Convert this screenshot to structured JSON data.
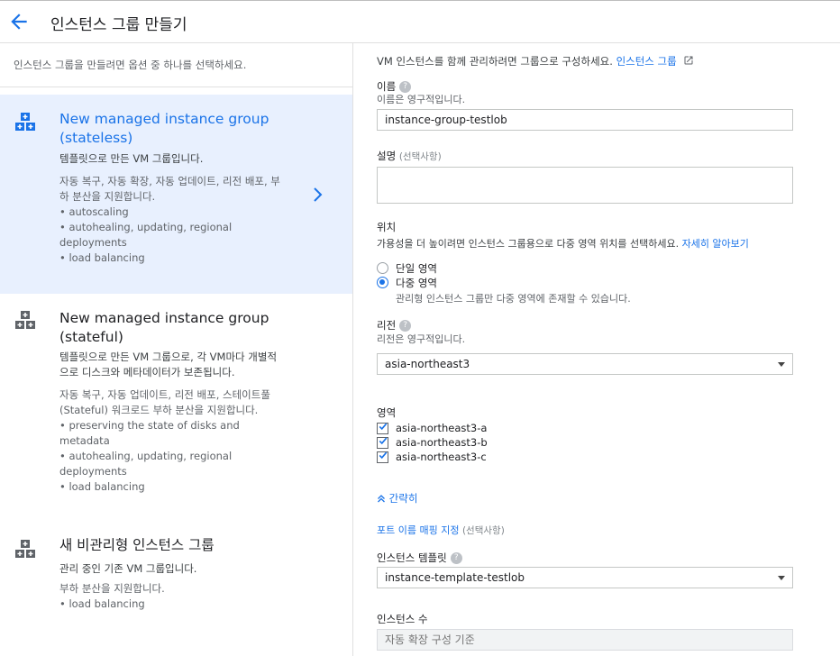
{
  "header": {
    "title": "인스턴스 그룹 만들기"
  },
  "left": {
    "intro": "인스턴스 그룹을 만들려면 옵션 중 하나를 선택하세요.",
    "options": [
      {
        "title_line1": "New managed instance group",
        "title_line2": "(stateless)",
        "subtitle": "템플릿으로 만든 VM 그룹입니다.",
        "details": [
          "자동 복구, 자동 확장, 자동 업데이트, 리전 배포, 부",
          "하 분산을 지원합니다.",
          "• autoscaling",
          "• autohealing, updating, regional",
          "deployments",
          "• load balancing"
        ]
      },
      {
        "title_line1": "New managed instance group",
        "title_line2": "(stateful)",
        "subtitle_lines": [
          "템플릿으로 만든 VM 그룹으로, 각 VM마다 개별적",
          "으로 디스크와 메타데이터가 보존됩니다."
        ],
        "details": [
          "자동 복구, 자동 업데이트, 리전 배포, 스테이트풀",
          "(Stateful) 워크로드 부하 분산을 지원합니다.",
          "• preserving the state of disks and",
          "metadata",
          "• autohealing, updating, regional",
          "deployments",
          "• load balancing"
        ]
      },
      {
        "title_line1": "새 비관리형 인스턴스 그룹",
        "subtitle": "관리 중인 기존 VM 그룹입니다.",
        "details": [
          "부하 분산을 지원합니다.",
          "• load balancing"
        ]
      }
    ]
  },
  "right": {
    "intro_text": "VM 인스턴스를 함께 관리하려면 그룹으로 구성하세요.",
    "intro_link": "인스턴스 그룹",
    "name": {
      "label": "이름",
      "help": "이름은 영구적입니다.",
      "value": "instance-group-testlob"
    },
    "description": {
      "label": "설명",
      "optional": "(선택사항)",
      "value": ""
    },
    "location": {
      "label": "위치",
      "help": "가용성을 더 높이려면 인스턴스 그룹용으로 다중 영역 위치를 선택하세요.",
      "help_link": "자세히 알아보기",
      "single_zone": "단일 영역",
      "multi_zone": "다중 영역",
      "multi_zone_help": "관리형 인스턴스 그룹만 다중 영역에 존재할 수 있습니다."
    },
    "region": {
      "label": "리전",
      "help": "리전은 영구적입니다.",
      "value": "asia-northeast3"
    },
    "zones": {
      "label": "영역",
      "items": [
        "asia-northeast3-a",
        "asia-northeast3-b",
        "asia-northeast3-c"
      ]
    },
    "collapse": "간략히",
    "port_mapping": {
      "link": "포트 이름 매핑 지정",
      "optional": "(선택사항)"
    },
    "template": {
      "label": "인스턴스 템플릿",
      "value": "instance-template-testlob"
    },
    "instance_count": {
      "label": "인스턴스 수",
      "placeholder": "자동 확장 구성 기준"
    }
  }
}
